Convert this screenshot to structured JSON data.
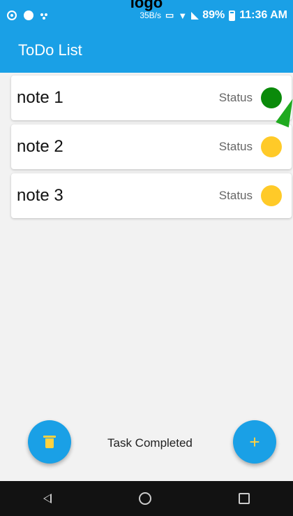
{
  "overlay": {
    "logo_text": "logo"
  },
  "status_bar": {
    "speed": "35B/s",
    "battery": "89%",
    "time": "11:36 AM",
    "icons": [
      "gear-icon",
      "circle-icon",
      "dots-icon",
      "cast-icon",
      "wifi-icon",
      "no-signal-icon",
      "battery-icon"
    ]
  },
  "app_bar": {
    "title": "ToDo List",
    "color": "#1aa0e6"
  },
  "notes": [
    {
      "title": "note 1",
      "status_label": "Status",
      "status_color": "#0a8a0a"
    },
    {
      "title": "note 2",
      "status_label": "Status",
      "status_color": "#ffca28"
    },
    {
      "title": "note 3",
      "status_label": "Status",
      "status_color": "#ffca28"
    }
  ],
  "bottom": {
    "delete_button_icon": "trash-icon",
    "task_completed_label": "Task Completed",
    "add_button_symbol": "+"
  },
  "nav_bar": {
    "icons": [
      "back-icon",
      "home-icon",
      "recents-icon"
    ]
  }
}
